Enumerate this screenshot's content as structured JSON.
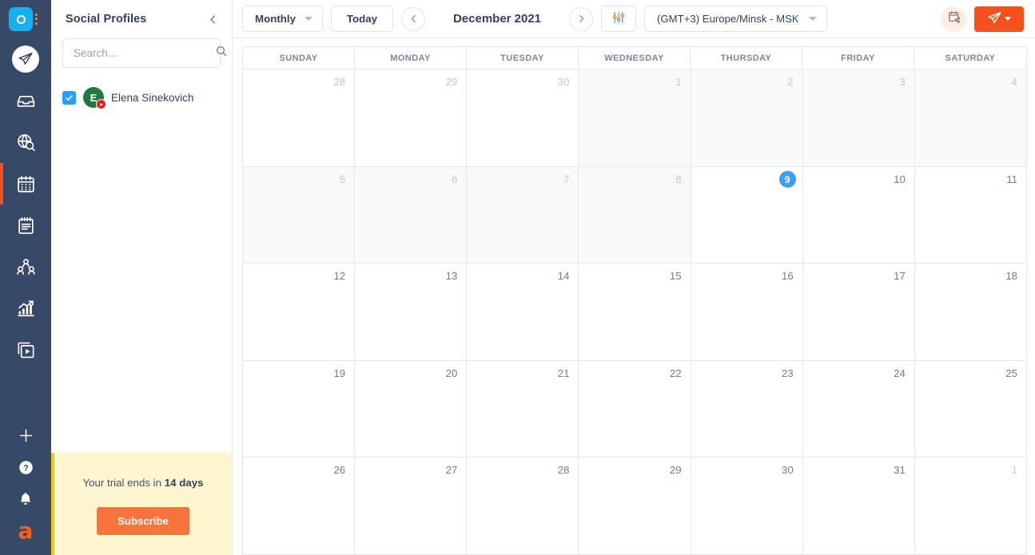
{
  "rail": {
    "logo": {
      "name": "app-logo",
      "icon": "ring-logo-icon"
    },
    "kebab": "kebab-menu-icon",
    "items": [
      {
        "key": "publish",
        "icon": "paper-plane-icon",
        "active": false
      },
      {
        "key": "inbox",
        "icon": "inbox-icon",
        "active": false
      },
      {
        "key": "discovery",
        "icon": "globe-search-icon",
        "active": false
      },
      {
        "key": "calendar",
        "icon": "calendar-icon",
        "active": true
      },
      {
        "key": "notes",
        "icon": "notepad-icon",
        "active": false
      },
      {
        "key": "audience",
        "icon": "users-icon",
        "active": false
      },
      {
        "key": "analytics",
        "icon": "bar-chart-icon",
        "active": false
      },
      {
        "key": "media",
        "icon": "video-library-icon",
        "active": false
      }
    ],
    "bottom": [
      {
        "key": "add",
        "icon": "plus-icon"
      },
      {
        "key": "help",
        "icon": "question-circle-icon"
      },
      {
        "key": "alerts",
        "icon": "bell-icon"
      },
      {
        "key": "brand",
        "icon": "brand-a-logo",
        "label": "a"
      }
    ]
  },
  "sidebar": {
    "title": "Social Profiles",
    "collapse_icon": "chevron-left-icon",
    "search": {
      "value": "",
      "placeholder": "Search...",
      "icon": "search-icon"
    },
    "profiles": [
      {
        "name": "Elena Sinekovich",
        "initial": "E",
        "network": "youtube",
        "checked": true,
        "avatar_color": "#1f7a3d",
        "badge_color": "#ee1d1d"
      }
    ],
    "trial": {
      "text_prefix": "Your trial ends in ",
      "text_strong": "14 days",
      "button_label": "Subscribe",
      "bg": "#fdf6cf",
      "accent": "#f6c915",
      "button_color": "#f9733c"
    }
  },
  "toolbar": {
    "view_label": "Monthly",
    "today_label": "Today",
    "prev_icon": "chevron-left-icon",
    "next_icon": "chevron-right-icon",
    "month_label": "December 2021",
    "filter_icon": "sliders-filter-icon",
    "timezone_label": "(GMT+3) Europe/Minsk - MSK",
    "share_icon": "calendar-share-icon",
    "compose_icon": "paper-plane-icon",
    "compose_caret_icon": "chevron-down-icon",
    "accent_color": "#f4511e"
  },
  "calendar": {
    "weekdays": [
      "SUNDAY",
      "MONDAY",
      "TUESDAY",
      "WEDNESDAY",
      "THURSDAY",
      "FRIDAY",
      "SATURDAY"
    ],
    "today": 9,
    "cells": [
      {
        "day": "28",
        "state": "out"
      },
      {
        "day": "29",
        "state": "out"
      },
      {
        "day": "30",
        "state": "out"
      },
      {
        "day": "1",
        "state": "past"
      },
      {
        "day": "2",
        "state": "past"
      },
      {
        "day": "3",
        "state": "past"
      },
      {
        "day": "4",
        "state": "past"
      },
      {
        "day": "5",
        "state": "past"
      },
      {
        "day": "6",
        "state": "past"
      },
      {
        "day": "7",
        "state": "past"
      },
      {
        "day": "8",
        "state": "past"
      },
      {
        "day": "9",
        "state": "today"
      },
      {
        "day": "10",
        "state": "future"
      },
      {
        "day": "11",
        "state": "future"
      },
      {
        "day": "12",
        "state": "future"
      },
      {
        "day": "13",
        "state": "future"
      },
      {
        "day": "14",
        "state": "future"
      },
      {
        "day": "15",
        "state": "future"
      },
      {
        "day": "16",
        "state": "future"
      },
      {
        "day": "17",
        "state": "future"
      },
      {
        "day": "18",
        "state": "future"
      },
      {
        "day": "19",
        "state": "future"
      },
      {
        "day": "20",
        "state": "future"
      },
      {
        "day": "21",
        "state": "future"
      },
      {
        "day": "22",
        "state": "future"
      },
      {
        "day": "23",
        "state": "future"
      },
      {
        "day": "24",
        "state": "future"
      },
      {
        "day": "25",
        "state": "future"
      },
      {
        "day": "26",
        "state": "future"
      },
      {
        "day": "27",
        "state": "future"
      },
      {
        "day": "28",
        "state": "future"
      },
      {
        "day": "29",
        "state": "future"
      },
      {
        "day": "30",
        "state": "future"
      },
      {
        "day": "31",
        "state": "future"
      },
      {
        "day": "1",
        "state": "out"
      }
    ]
  }
}
